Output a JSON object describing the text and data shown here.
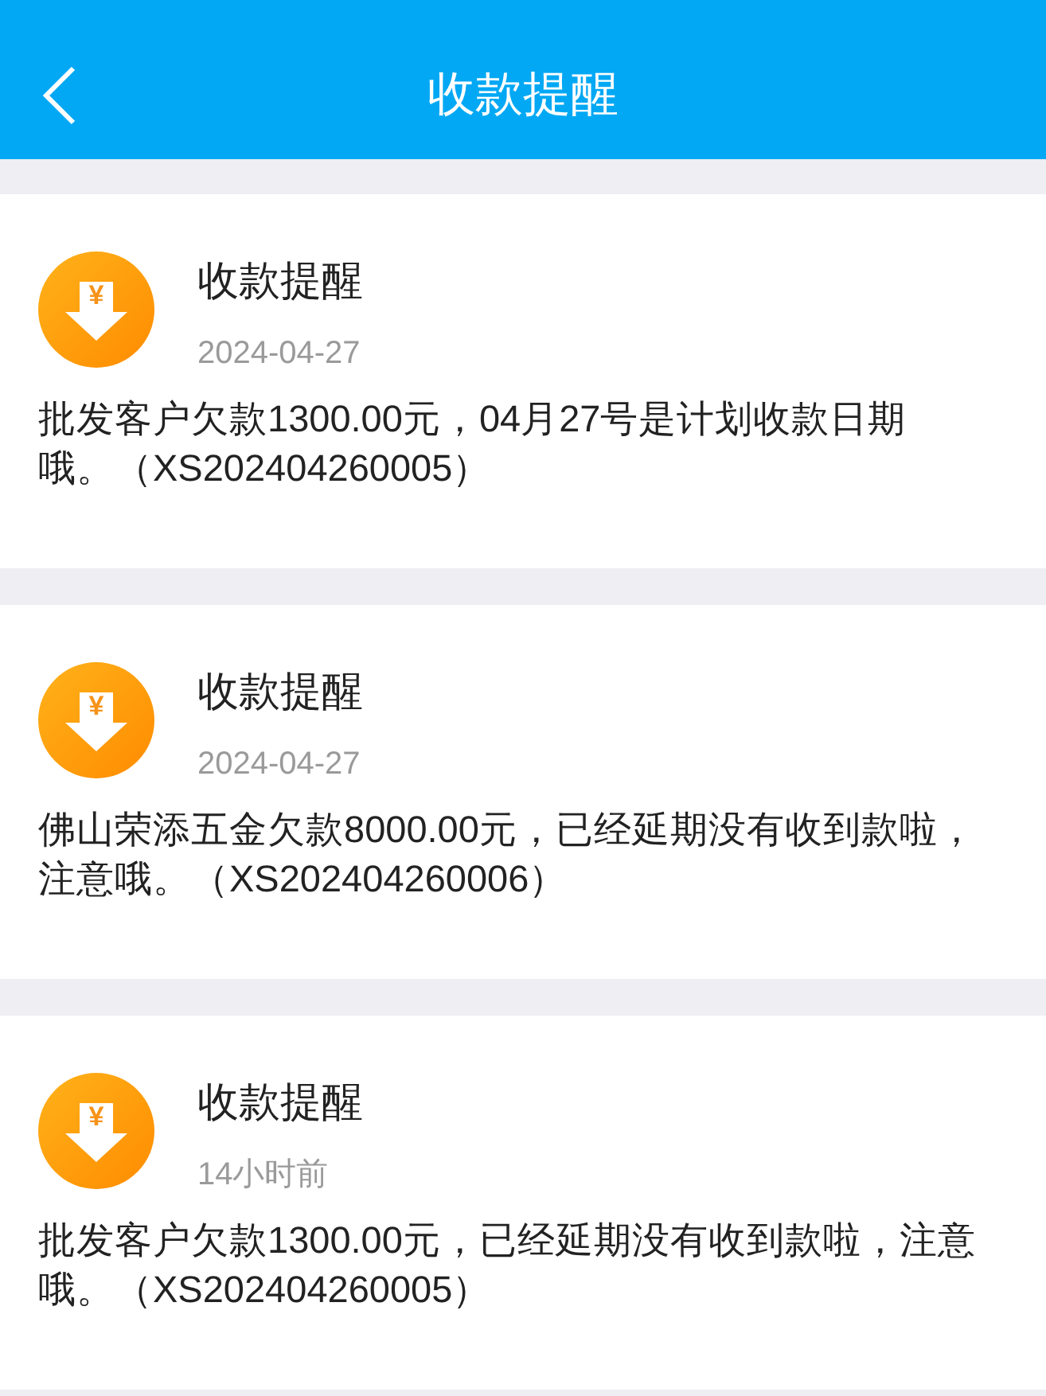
{
  "header": {
    "title": "收款提醒"
  },
  "notifications": [
    {
      "icon_symbol": "¥",
      "title": "收款提醒",
      "time": "2024-04-27",
      "message": "批发客户欠款1300.00元，04月27号是计划收款日期哦。（XS202404260005）"
    },
    {
      "icon_symbol": "¥",
      "title": "收款提醒",
      "time": "2024-04-27",
      "message": "佛山荣添五金欠款8000.00元，已经延期没有收到款啦，注意哦。（XS202404260006）"
    },
    {
      "icon_symbol": "¥",
      "title": "收款提醒",
      "time": "14小时前",
      "message": "批发客户欠款1300.00元，已经延期没有收到款啦，注意哦。（XS202404260005）"
    }
  ]
}
